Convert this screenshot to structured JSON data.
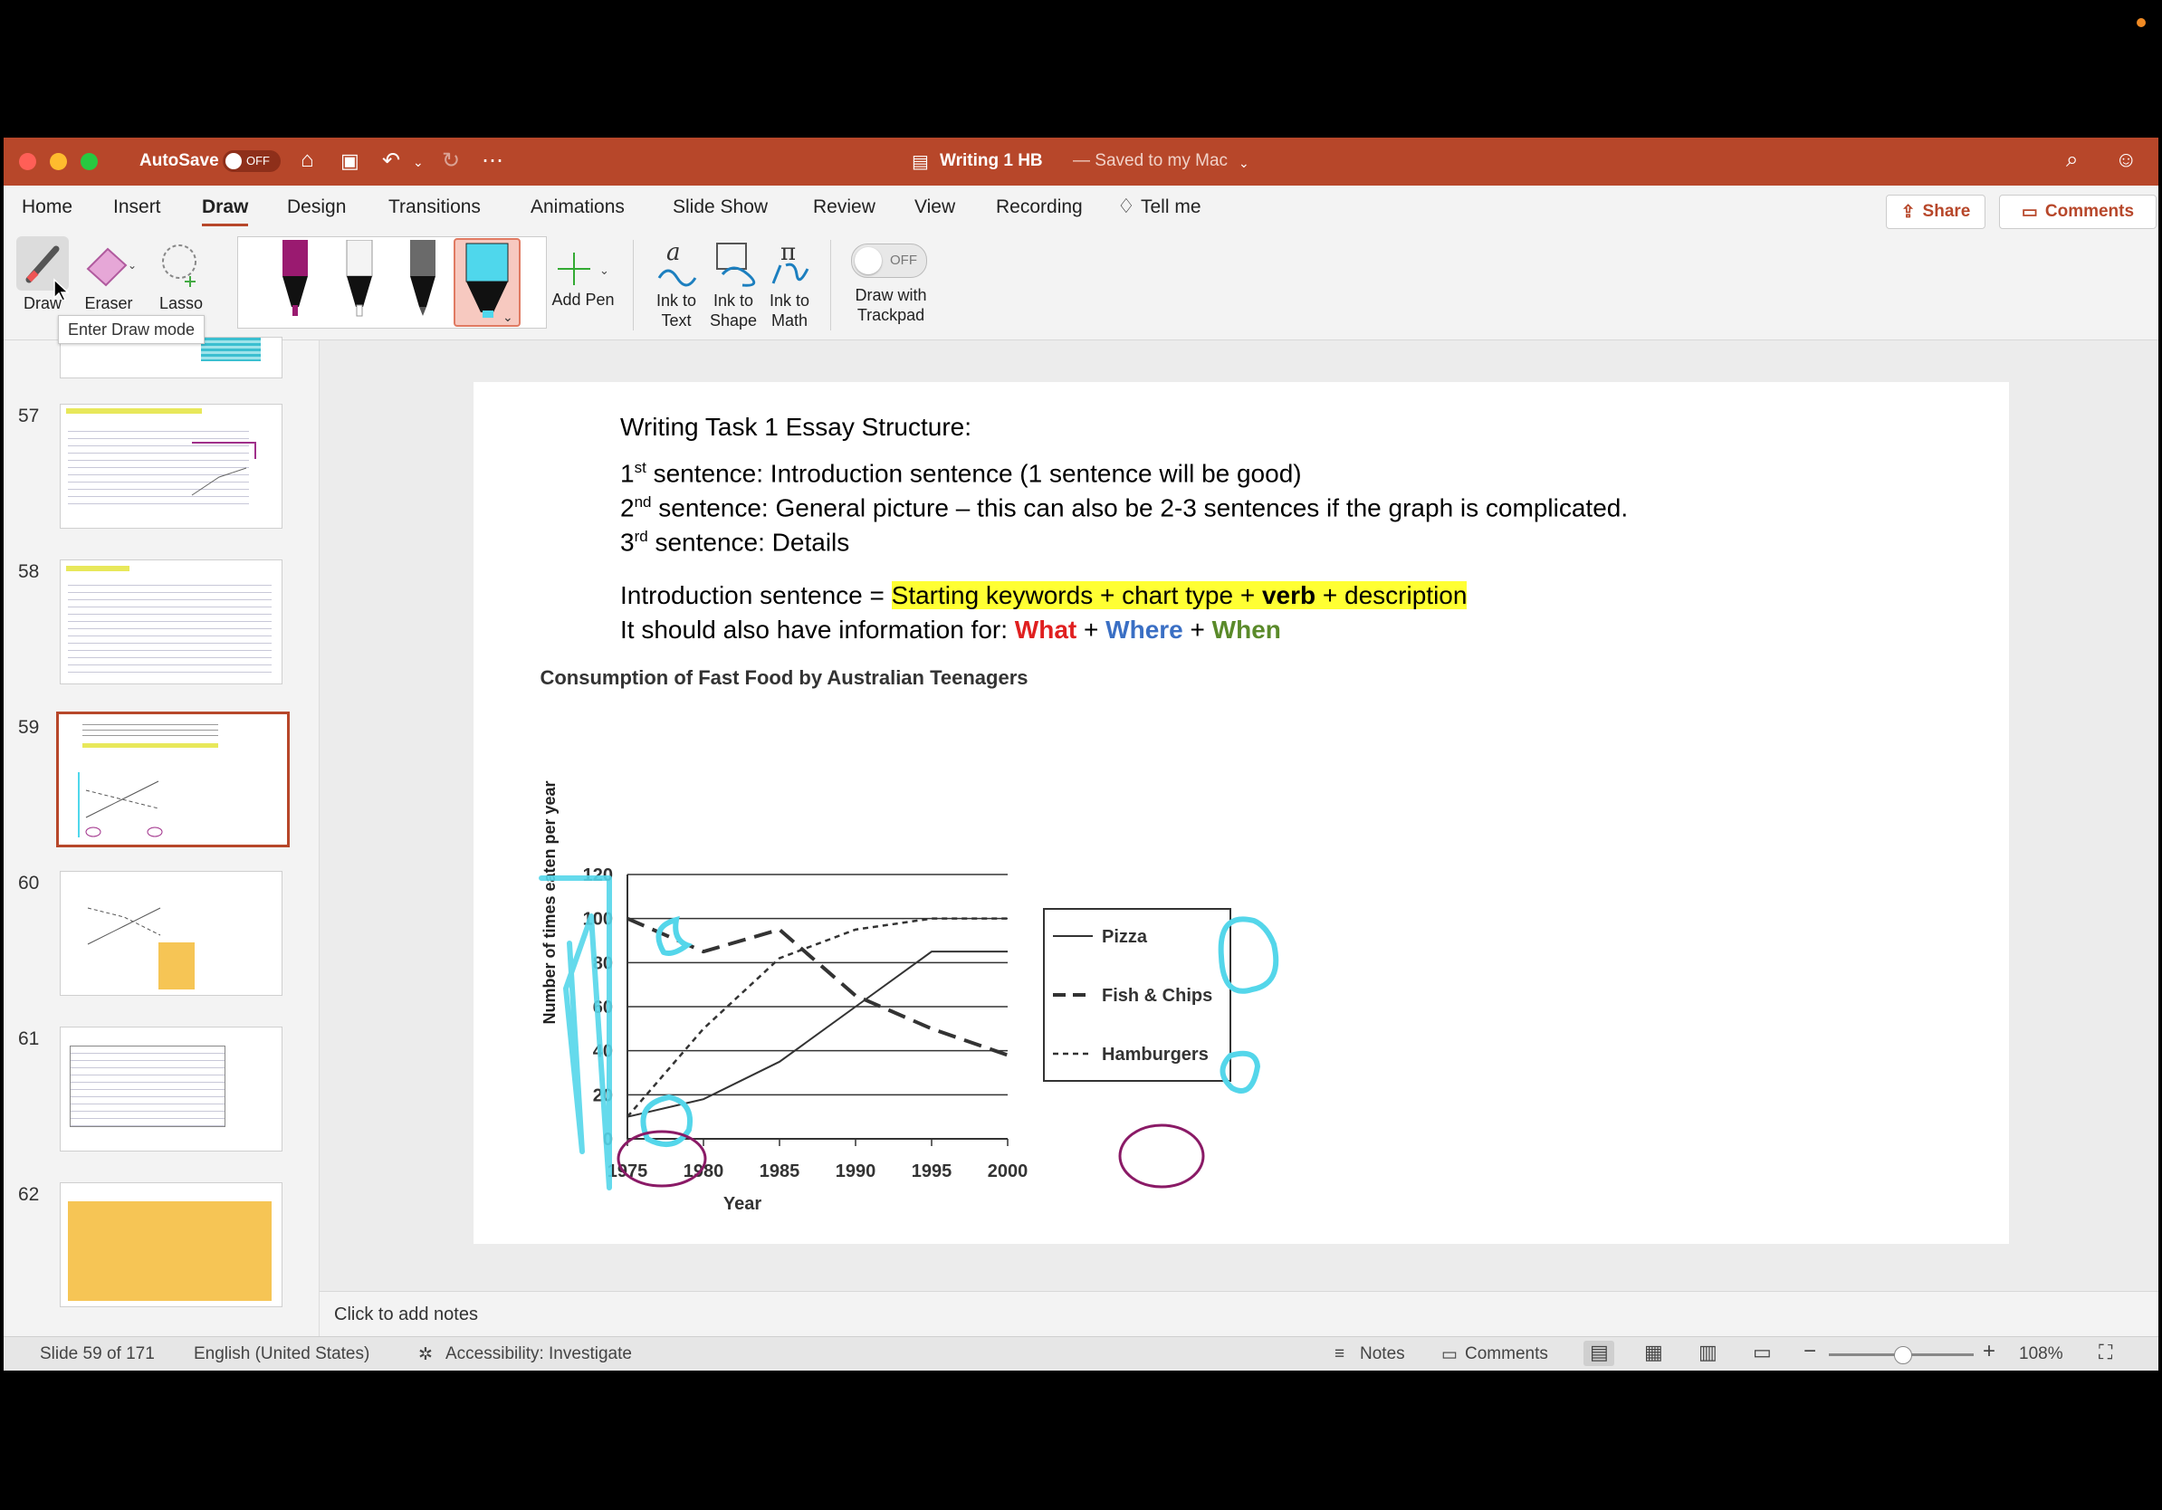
{
  "window": {
    "autosave_label": "AutoSave",
    "autosave_state": "OFF",
    "doc_title": "Writing 1 HB",
    "doc_status": "— Saved to my Mac",
    "accent": "#b7472a"
  },
  "tabs": [
    "Home",
    "Insert",
    "Draw",
    "Design",
    "Transitions",
    "Animations",
    "Slide Show",
    "Review",
    "View",
    "Recording",
    "Tell me"
  ],
  "share_label": "Share",
  "comments_label": "Comments",
  "ribbon": {
    "draw": "Draw",
    "eraser": "Eraser",
    "lasso": "Lasso",
    "add_pen": "Add Pen",
    "ink_to_text": [
      "Ink to",
      "Text"
    ],
    "ink_to_shape": [
      "Ink to",
      "Shape"
    ],
    "ink_to_math": [
      "Ink to",
      "Math"
    ],
    "trackpad_toggle": "OFF",
    "draw_trackpad": [
      "Draw with",
      "Trackpad"
    ],
    "tooltip": "Enter Draw mode"
  },
  "thumbnails": [
    "57",
    "58",
    "59",
    "60",
    "61",
    "62"
  ],
  "selected_slide": "59",
  "slide": {
    "heading": "Writing Task 1 Essay Structure:",
    "line1_num": "1",
    "line1_sup": "st",
    "line1_rest": " sentence: Introduction sentence (1 sentence will be good)",
    "line2_num": "2",
    "line2_sup": "nd",
    "line2_rest": " sentence: General picture – this can also be 2-3 sentences if the graph is complicated.",
    "line3_num": "3",
    "line3_sup": "rd",
    "line3_rest": " sentence: Details",
    "intro_prefix": "Introduction sentence = ",
    "intro_hl_a": "Starting keywords + chart type + ",
    "intro_hl_verb": "verb",
    "intro_hl_b": " + description",
    "info_prefix": "It should also have information for: ",
    "what": "What",
    "plus1": " + ",
    "where": "Where",
    "plus2": " + ",
    "when": "When"
  },
  "chart_data": {
    "type": "line",
    "title": "Consumption of Fast Food by Australian Teenagers",
    "xlabel": "Year",
    "ylabel": "Number of times eaten per year",
    "x": [
      1975,
      1980,
      1985,
      1990,
      1995,
      2000
    ],
    "xticks": [
      "1975",
      "1980",
      "1985",
      "1990",
      "1995",
      "2000"
    ],
    "yticks": [
      "0",
      "20",
      "40",
      "60",
      "80",
      "100",
      "120"
    ],
    "ylim": [
      0,
      120
    ],
    "series": [
      {
        "name": "Pizza",
        "style": "solid",
        "values": [
          10,
          18,
          35,
          60,
          85,
          85
        ]
      },
      {
        "name": "Fish & Chips",
        "style": "dashed",
        "values": [
          100,
          85,
          95,
          65,
          50,
          38
        ]
      },
      {
        "name": "Hamburgers",
        "style": "dotted",
        "values": [
          10,
          50,
          82,
          95,
          100,
          100
        ]
      }
    ],
    "legend": "right"
  },
  "notes_placeholder": "Click to add notes",
  "status": {
    "slide": "Slide 59 of 171",
    "language": "English (United States)",
    "accessibility": "Accessibility: Investigate",
    "notes": "Notes",
    "comments": "Comments",
    "zoom": "108%"
  }
}
